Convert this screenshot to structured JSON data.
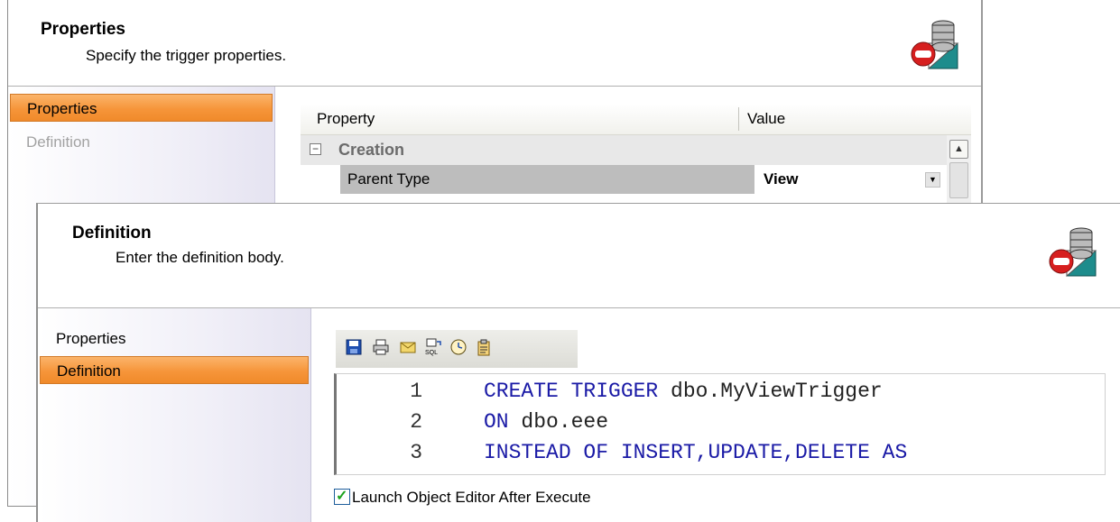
{
  "properties_dialog": {
    "title": "Properties",
    "subtitle": "Specify the trigger properties.",
    "nav": [
      "Properties",
      "Definition"
    ],
    "grid": {
      "col_property": "Property",
      "col_value": "Value",
      "category": "Creation",
      "category_toggle": "⊟",
      "row_name": "Parent Type",
      "row_value": "View"
    }
  },
  "definition_dialog": {
    "title": "Definition",
    "subtitle": "Enter the definition body.",
    "nav": [
      "Properties",
      "Definition"
    ],
    "toolbar_icons": [
      "save-icon",
      "print-icon",
      "email-icon",
      "sql-icon",
      "schedule-icon",
      "paste-icon"
    ],
    "code_lines": [
      {
        "num": "1",
        "kw1": "CREATE TRIGGER",
        "rest": " dbo.MyViewTrigger"
      },
      {
        "num": "2",
        "kw1": "ON",
        "rest": " dbo.eee"
      },
      {
        "num": "3",
        "kw1": "INSTEAD OF INSERT,UPDATE,DELETE AS",
        "rest": ""
      }
    ],
    "launch_checkbox_label": "Launch Object Editor After Execute",
    "launch_checked": true
  },
  "colors": {
    "active_nav": "#f6953a",
    "keyword": "#1a1aa6",
    "category_text": "#6b6b6b"
  }
}
